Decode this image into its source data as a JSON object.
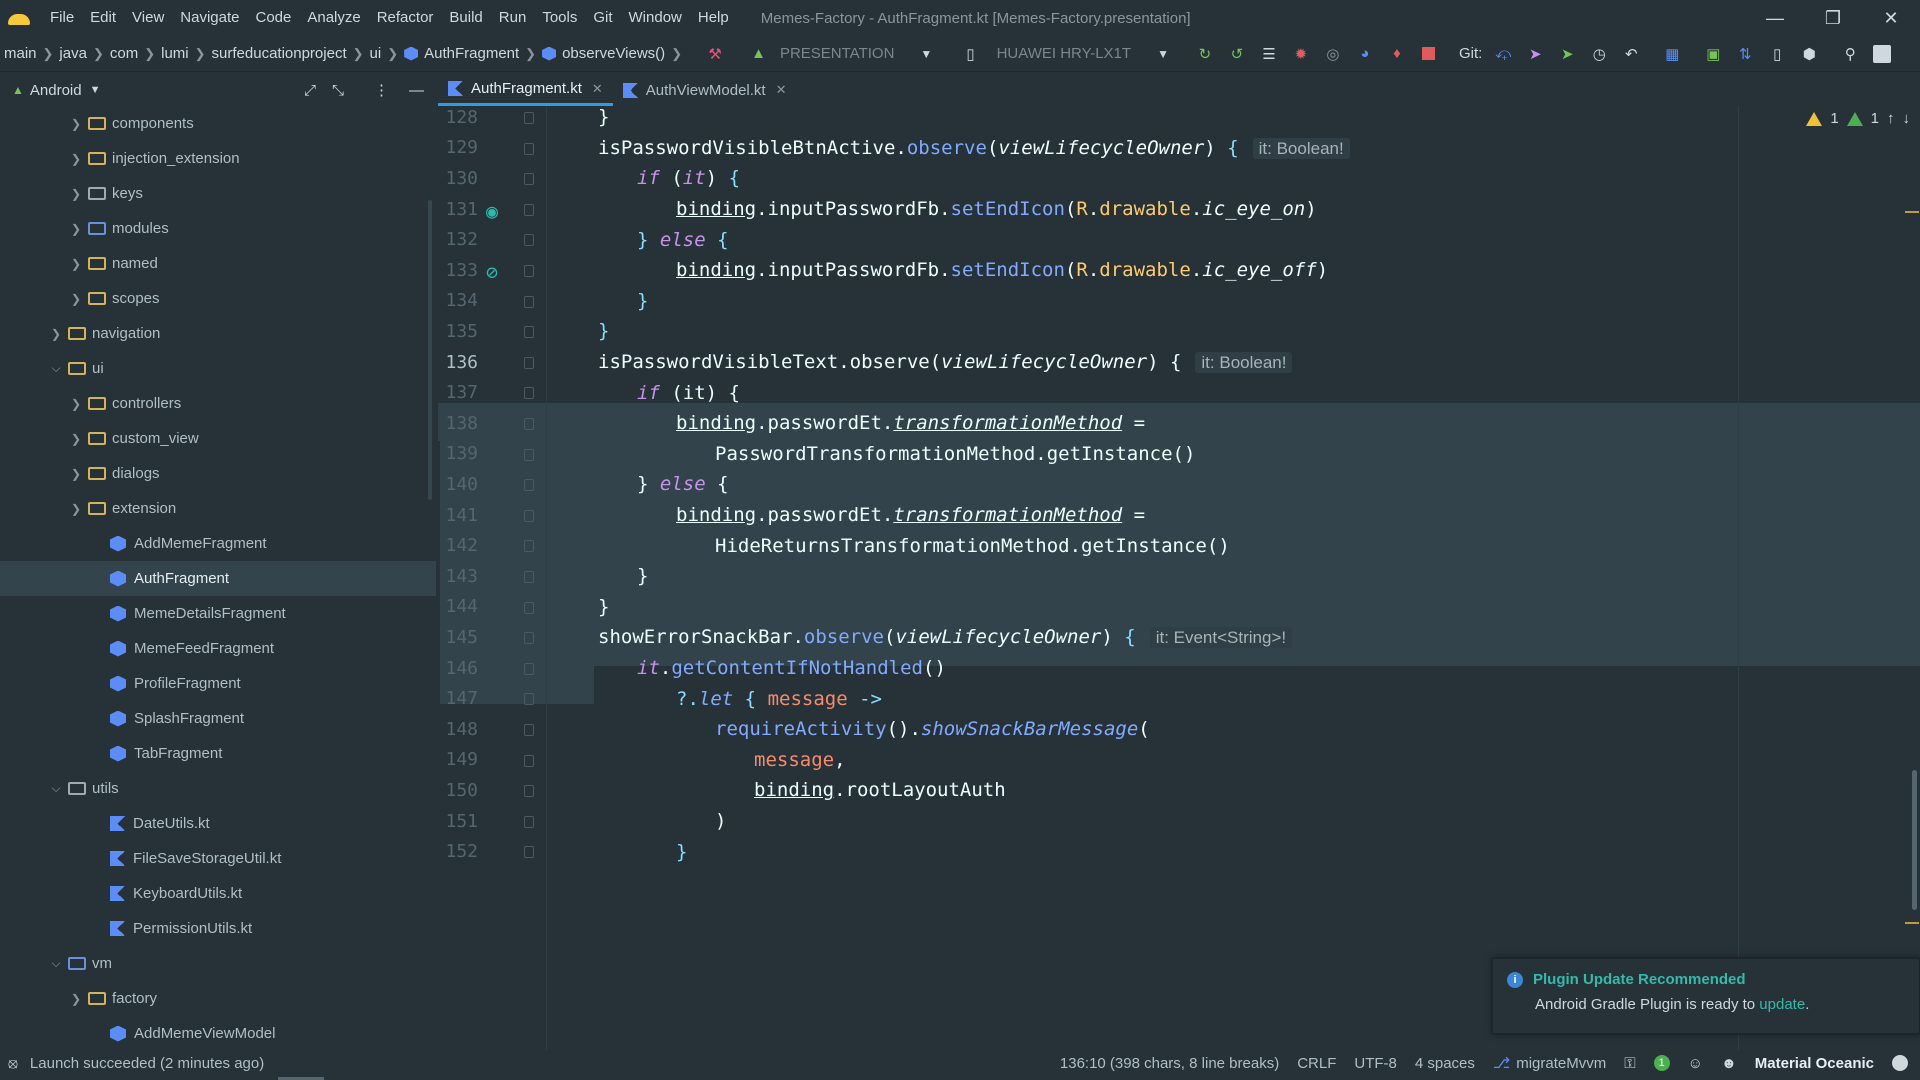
{
  "titlebar": {
    "menu": [
      "File",
      "Edit",
      "View",
      "Navigate",
      "Code",
      "Analyze",
      "Refactor",
      "Build",
      "Run",
      "Tools",
      "Git",
      "Window",
      "Help"
    ],
    "window_title": "Memes-Factory - AuthFragment.kt [Memes-Factory.presentation]"
  },
  "navbar": {
    "breadcrumbs": [
      "main",
      "java",
      "com",
      "lumi",
      "surfeducationproject",
      "ui",
      "AuthFragment",
      "observeViews()"
    ],
    "run_config": "PRESENTATION",
    "device": "HUAWEI HRY-LX1T",
    "git_label": "Git:"
  },
  "project": {
    "view_mode": "Android",
    "tree": [
      {
        "label": "components",
        "depth": 2,
        "icon": "folder",
        "expand": "collapsed"
      },
      {
        "label": "injection_extension",
        "depth": 2,
        "icon": "folder",
        "expand": "collapsed"
      },
      {
        "label": "keys",
        "depth": 2,
        "icon": "folder-grey",
        "expand": "collapsed"
      },
      {
        "label": "modules",
        "depth": 2,
        "icon": "folder-blue",
        "expand": "collapsed"
      },
      {
        "label": "named",
        "depth": 2,
        "icon": "folder",
        "expand": "collapsed"
      },
      {
        "label": "scopes",
        "depth": 2,
        "icon": "folder",
        "expand": "collapsed"
      },
      {
        "label": "navigation",
        "depth": 1,
        "icon": "folder",
        "expand": "collapsed"
      },
      {
        "label": "ui",
        "depth": 1,
        "icon": "folder",
        "expand": "expanded"
      },
      {
        "label": "controllers",
        "depth": 2,
        "icon": "folder",
        "expand": "collapsed"
      },
      {
        "label": "custom_view",
        "depth": 2,
        "icon": "folder",
        "expand": "collapsed"
      },
      {
        "label": "dialogs",
        "depth": 2,
        "icon": "folder",
        "expand": "collapsed"
      },
      {
        "label": "extension",
        "depth": 2,
        "icon": "folder",
        "expand": "collapsed"
      },
      {
        "label": "AddMemeFragment",
        "depth": 2,
        "icon": "class",
        "expand": "none"
      },
      {
        "label": "AuthFragment",
        "depth": 2,
        "icon": "class",
        "expand": "none",
        "selected": true
      },
      {
        "label": "MemeDetailsFragment",
        "depth": 2,
        "icon": "class",
        "expand": "none"
      },
      {
        "label": "MemeFeedFragment",
        "depth": 2,
        "icon": "class",
        "expand": "none"
      },
      {
        "label": "ProfileFragment",
        "depth": 2,
        "icon": "class",
        "expand": "none"
      },
      {
        "label": "SplashFragment",
        "depth": 2,
        "icon": "class",
        "expand": "none"
      },
      {
        "label": "TabFragment",
        "depth": 2,
        "icon": "class",
        "expand": "none"
      },
      {
        "label": "utils",
        "depth": 1,
        "icon": "folder-grey",
        "expand": "expanded"
      },
      {
        "label": "DateUtils.kt",
        "depth": 2,
        "icon": "kotlin",
        "expand": "none"
      },
      {
        "label": "FileSaveStorageUtil.kt",
        "depth": 2,
        "icon": "kotlin",
        "expand": "none"
      },
      {
        "label": "KeyboardUtils.kt",
        "depth": 2,
        "icon": "kotlin",
        "expand": "none"
      },
      {
        "label": "PermissionUtils.kt",
        "depth": 2,
        "icon": "kotlin",
        "expand": "none"
      },
      {
        "label": "vm",
        "depth": 1,
        "icon": "folder-blue",
        "expand": "expanded"
      },
      {
        "label": "factory",
        "depth": 2,
        "icon": "folder",
        "expand": "collapsed"
      },
      {
        "label": "AddMemeViewModel",
        "depth": 2,
        "icon": "class",
        "expand": "none"
      }
    ]
  },
  "tabs": [
    {
      "label": "AuthFragment.kt",
      "active": true
    },
    {
      "label": "AuthViewModel.kt",
      "active": false
    }
  ],
  "inspections": {
    "warnings": "1",
    "ok": "1"
  },
  "code_lines": [
    {
      "n": "128",
      "indent": 0,
      "html": "}"
    },
    {
      "n": "129",
      "indent": 0,
      "html": "isPasswordVisibleBtnActive.<span class='fn'>observe</span>(<span class='it'>viewLifecycleOwner</span>) <span class='par'>{</span>",
      "hint": "it: Boolean!"
    },
    {
      "n": "130",
      "indent": 1,
      "html": "<span class='kw'>if</span> (<span class='kw'>it</span>) <span class='par'>{</span>"
    },
    {
      "n": "131",
      "indent": 2,
      "html": "<span class='ul'>binding</span>.inputPasswordFb.<span class='fn'>setEndIcon</span>(<span class='res'>R</span>.<span class='res'>drawable</span>.<span class='it'>ic_eye_on</span>)",
      "gutter": "eye"
    },
    {
      "n": "132",
      "indent": 1,
      "html": "<span class='par'>}</span> <span class='kw'>else</span> <span class='par'>{</span>"
    },
    {
      "n": "133",
      "indent": 2,
      "html": "<span class='ul'>binding</span>.inputPasswordFb.<span class='fn'>setEndIcon</span>(<span class='res'>R</span>.<span class='res'>drawable</span>.<span class='it'>ic_eye_off</span>)",
      "gutter": "eye-off"
    },
    {
      "n": "134",
      "indent": 1,
      "html": "<span class='par'>}</span>"
    },
    {
      "n": "135",
      "indent": 0,
      "html": "<span class='par'>}</span>"
    },
    {
      "n": "136",
      "indent": 0,
      "html": "isPasswordVisibleText.observe(<span class='it'>viewLifecycleOwner</span>) {",
      "hint": "it: Boolean!",
      "current": true
    },
    {
      "n": "137",
      "indent": 1,
      "html": "<span class='kw'>if</span> (it) {"
    },
    {
      "n": "138",
      "indent": 2,
      "html": "<span class='ul'>binding</span>.passwordEt.<span class='it ul'>transformationMethod</span> ="
    },
    {
      "n": "139",
      "indent": 3,
      "html": "PasswordTransformationMethod.getInstance()"
    },
    {
      "n": "140",
      "indent": 1,
      "html": "} <span class='kw'>else</span> {"
    },
    {
      "n": "141",
      "indent": 2,
      "html": "<span class='ul'>binding</span>.passwordEt.<span class='it ul'>transformationMethod</span> ="
    },
    {
      "n": "142",
      "indent": 3,
      "html": "HideReturnsTransformationMethod.getInstance()"
    },
    {
      "n": "143",
      "indent": 1,
      "html": "}"
    },
    {
      "n": "144",
      "indent": 0,
      "html": "}"
    },
    {
      "n": "145",
      "indent": 0,
      "html": "showErrorSnackBar.<span class='fn'>observe</span>(<span class='it'>viewLifecycleOwner</span>) <span class='par'>{</span>",
      "hint": "it: Event<String>!"
    },
    {
      "n": "146",
      "indent": 1,
      "html": "<span class='kw'>it</span>.<span class='fn'>getContentIfNotHandled</span>()"
    },
    {
      "n": "147",
      "indent": 2,
      "html": "<span class='par'>?.</span><span class='fn it'>let</span> <span class='par'>{</span> <span class='str'>message</span> <span class='par'>-&gt;</span>"
    },
    {
      "n": "148",
      "indent": 3,
      "html": "<span class='fn'>requireActivity</span>().<span class='fn it'>showSnackBarMessage</span>("
    },
    {
      "n": "149",
      "indent": 4,
      "html": "<span class='str'>message</span>,"
    },
    {
      "n": "150",
      "indent": 4,
      "html": "<span class='ul'>binding</span>.rootLayoutAuth"
    },
    {
      "n": "151",
      "indent": 3,
      "html": ")"
    },
    {
      "n": "152",
      "indent": 2,
      "html": "<span class='par'>}</span>"
    }
  ],
  "notification": {
    "title": "Plugin Update Recommended",
    "body": "Android Gradle Plugin is ready to",
    "link": "update",
    "suffix": "."
  },
  "status": {
    "message": "Launch succeeded (2 minutes ago)",
    "position": "136:10 (398 chars, 8 line breaks)",
    "line_sep": "CRLF",
    "encoding": "UTF-8",
    "indent": "4 spaces",
    "branch": "migrateMvvm",
    "events": "1",
    "theme": "Material Oceanic"
  },
  "colors": {
    "background": "#263238",
    "accent": "#2f9be0",
    "selection": "#32434b"
  }
}
